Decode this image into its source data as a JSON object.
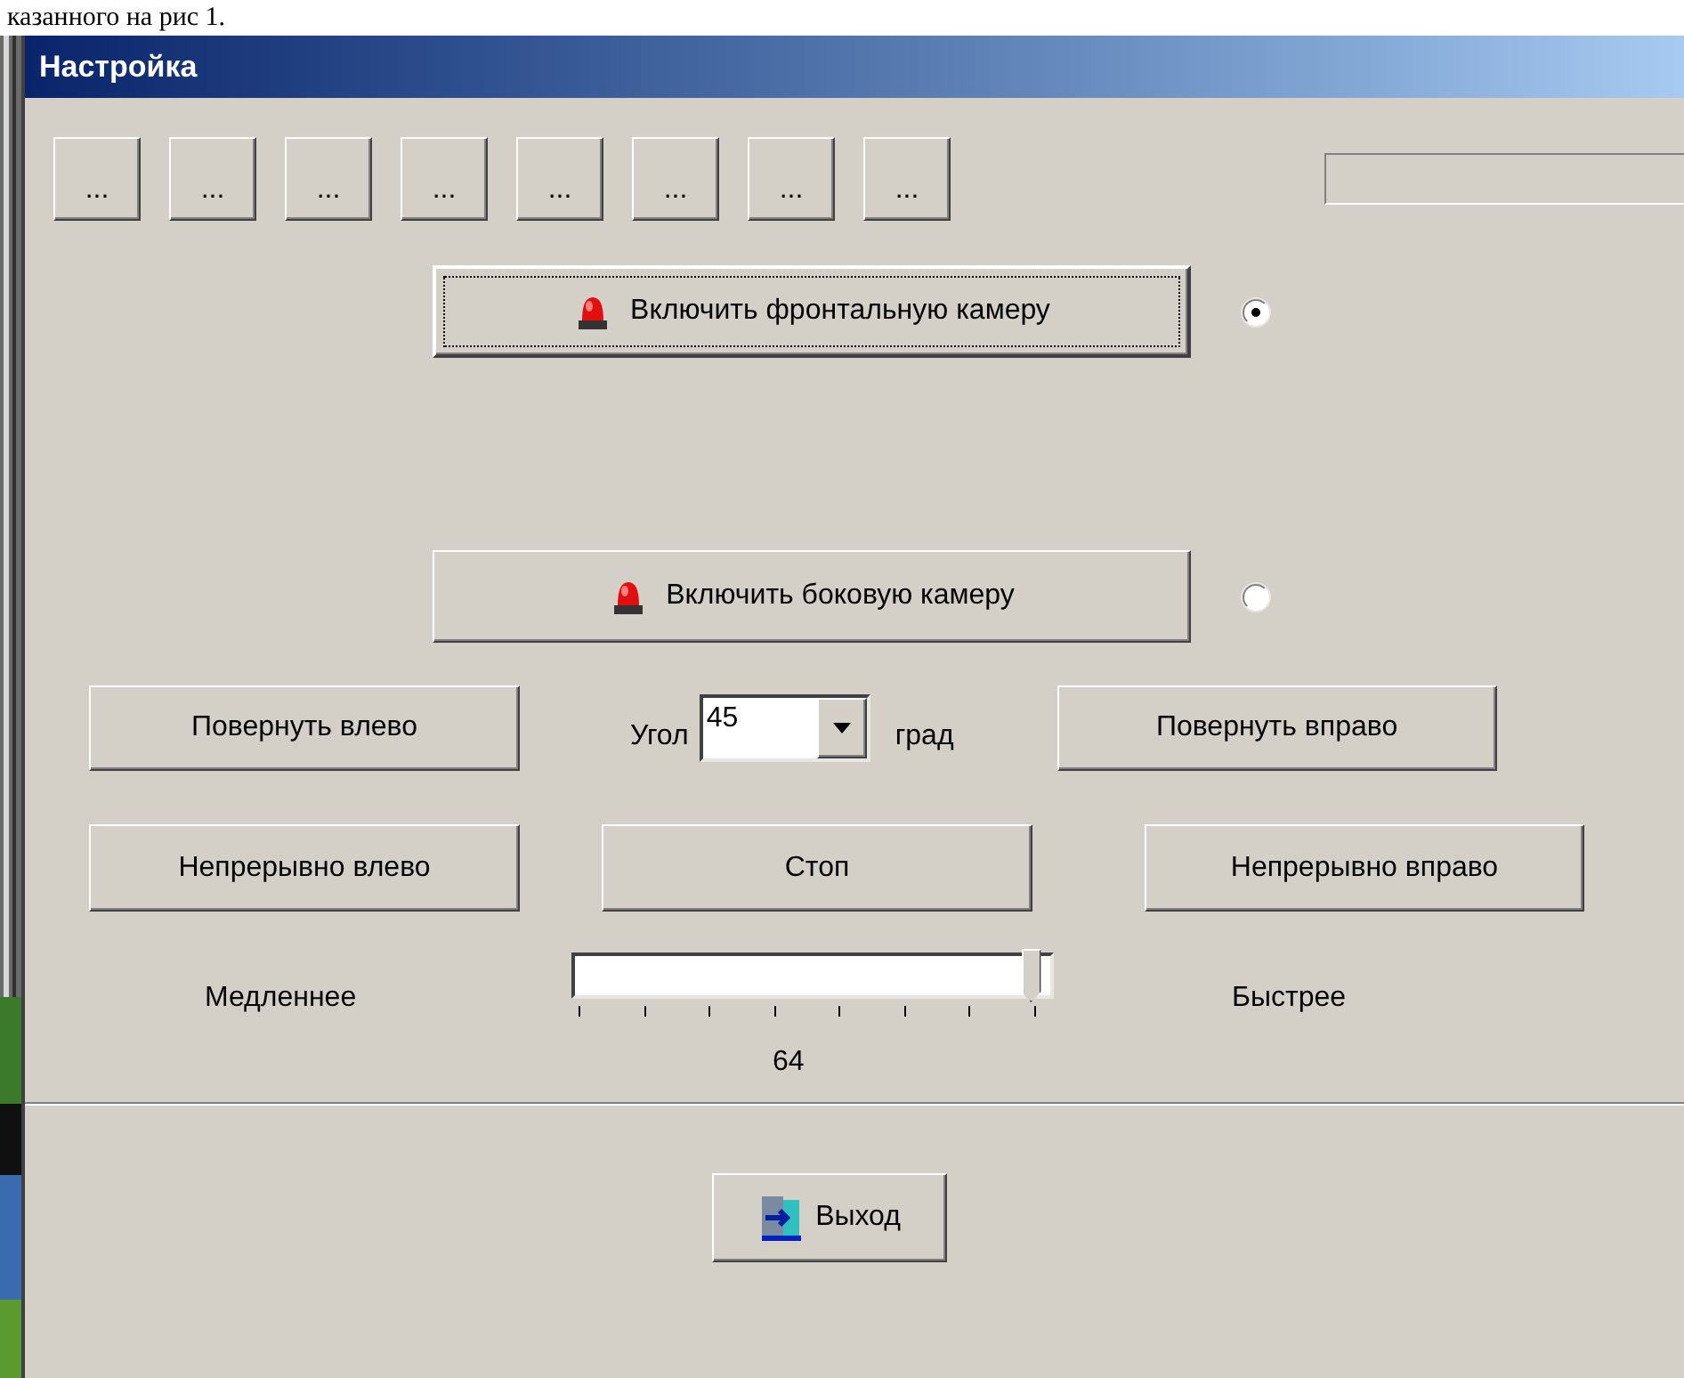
{
  "document_text": "казанного на рис 1.",
  "window": {
    "title": "Настройка"
  },
  "toolbar_buttons": [
    "...",
    "...",
    "...",
    "...",
    "...",
    "...",
    "...",
    "..."
  ],
  "cameras": [
    {
      "label": "Включить фронтальную камеру",
      "selected": true
    },
    {
      "label": "Включить боковую камеру",
      "selected": false
    }
  ],
  "rotate_row": {
    "left_button": "Повернуть влево",
    "angle_label": "Угол",
    "angle_value": "45",
    "unit": "град",
    "right_button": "Повернуть вправо"
  },
  "continuous_row": [
    "Непрерывно влево",
    "Стоп",
    "Непрерывно вправо"
  ],
  "speed": {
    "slow_label": "Медленнее",
    "fast_label": "Быстрее",
    "level": 0.98,
    "value": "64"
  },
  "exit_button": "Выход"
}
